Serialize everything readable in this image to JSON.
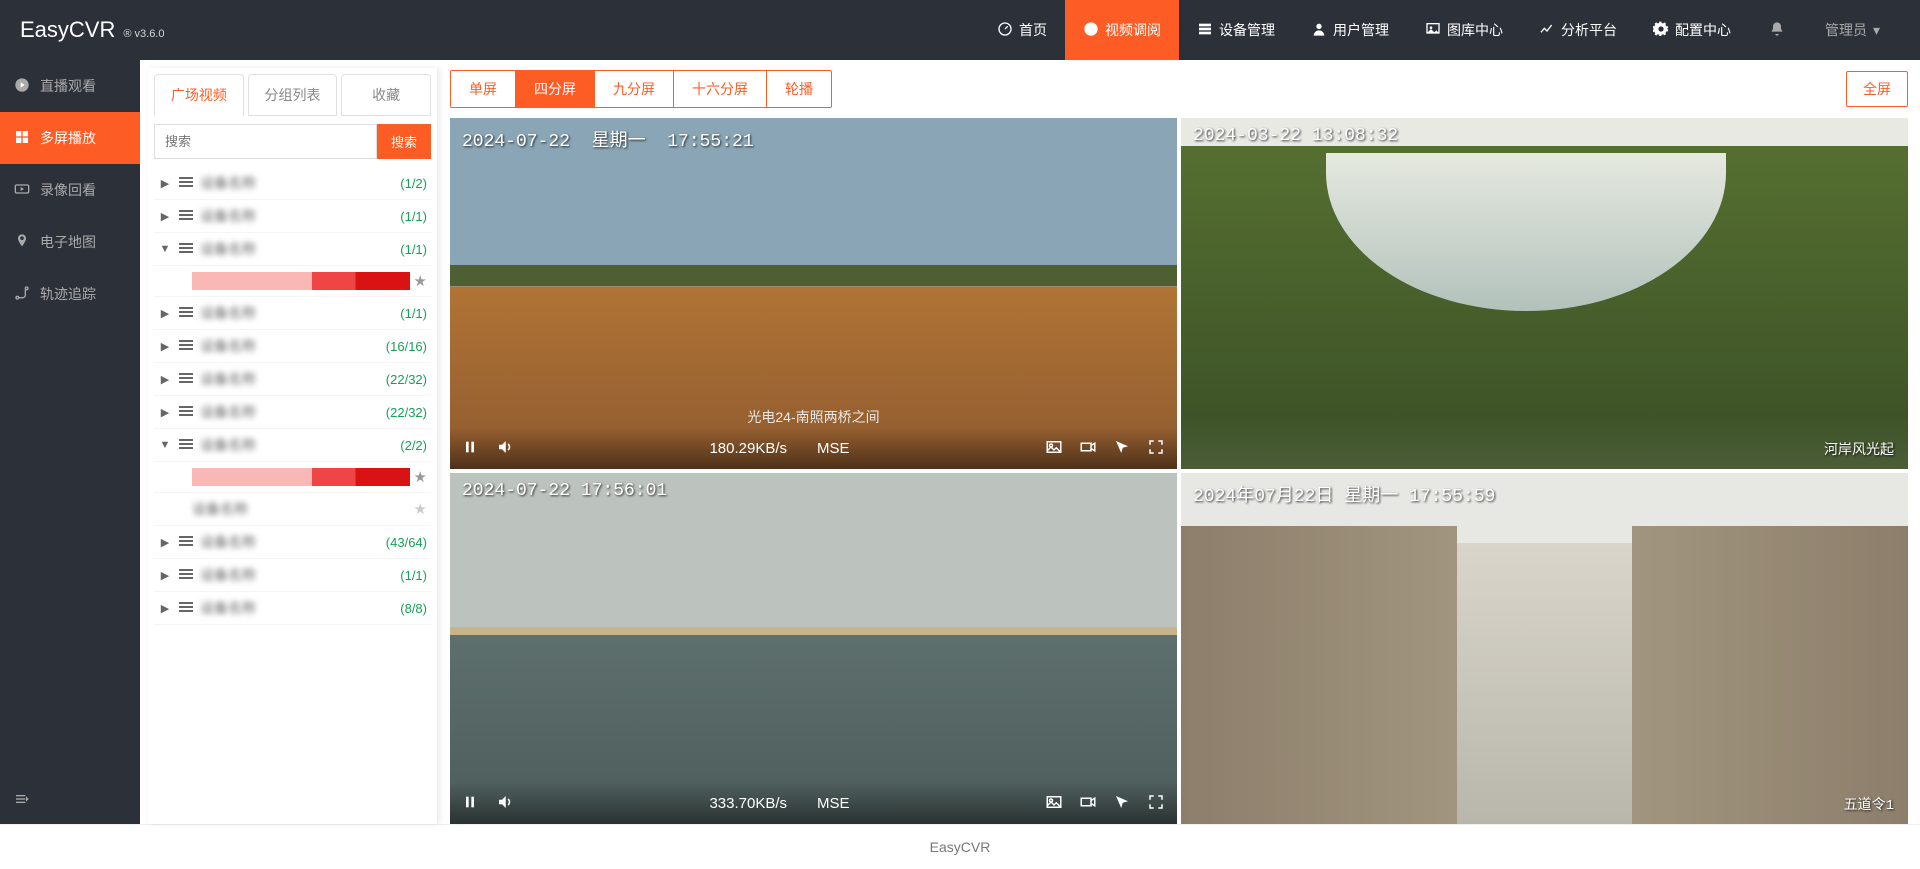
{
  "logo": {
    "title": "EasyCVR",
    "version": "® v3.6.0"
  },
  "nav": [
    {
      "label": "首页",
      "icon": "dashboard-icon"
    },
    {
      "label": "视频调阅",
      "icon": "play-icon",
      "active": true
    },
    {
      "label": "设备管理",
      "icon": "device-icon"
    },
    {
      "label": "用户管理",
      "icon": "user-icon"
    },
    {
      "label": "图库中心",
      "icon": "gallery-icon"
    },
    {
      "label": "分析平台",
      "icon": "chart-icon"
    },
    {
      "label": "配置中心",
      "icon": "gear-icon"
    }
  ],
  "admin": {
    "label": "管理员"
  },
  "sidebar": [
    {
      "label": "直播观看",
      "icon": "play-icon"
    },
    {
      "label": "多屏播放",
      "icon": "grid-icon",
      "active": true
    },
    {
      "label": "录像回看",
      "icon": "rewind-icon"
    },
    {
      "label": "电子地图",
      "icon": "map-icon"
    },
    {
      "label": "轨迹追踪",
      "icon": "route-icon"
    }
  ],
  "treeTabs": [
    {
      "label": "广场视频",
      "active": true
    },
    {
      "label": "分组列表"
    },
    {
      "label": "收藏"
    }
  ],
  "search": {
    "placeholder": "搜索",
    "button": "搜索"
  },
  "tree": [
    {
      "arrow": "▶",
      "indent": 0,
      "count": "(1/2)"
    },
    {
      "arrow": "▶",
      "indent": 0,
      "count": "(1/1)"
    },
    {
      "arrow": "▼",
      "indent": 0,
      "count": "(1/1)"
    },
    {
      "arrow": "",
      "indent": 1,
      "count": "",
      "redactedRed": true,
      "star": true
    },
    {
      "arrow": "▶",
      "indent": 0,
      "count": "(1/1)"
    },
    {
      "arrow": "▶",
      "indent": 0,
      "count": "(16/16)"
    },
    {
      "arrow": "▶",
      "indent": 0,
      "count": "(22/32)"
    },
    {
      "arrow": "▶",
      "indent": 0,
      "count": "(22/32)"
    },
    {
      "arrow": "▼",
      "indent": 0,
      "count": "(2/2)"
    },
    {
      "arrow": "",
      "indent": 1,
      "count": "",
      "redactedRed": true,
      "star": true
    },
    {
      "arrow": "",
      "indent": 1,
      "count": "",
      "starGray": true
    },
    {
      "arrow": "▶",
      "indent": 0,
      "count": "(43/64)"
    },
    {
      "arrow": "▶",
      "indent": 0,
      "count": "(1/1)"
    },
    {
      "arrow": "▶",
      "indent": 0,
      "count": "(8/8)"
    }
  ],
  "toolbar": {
    "layouts": [
      {
        "label": "单屏"
      },
      {
        "label": "四分屏",
        "active": true
      },
      {
        "label": "九分屏"
      },
      {
        "label": "十六分屏"
      },
      {
        "label": "轮播"
      }
    ],
    "fullscreen": "全屏"
  },
  "videos": [
    {
      "osd_tl": "2024-07-22  星期一  17:55:21",
      "scene": "river",
      "controls": true,
      "bitrate": "180.29KB/s",
      "codec": "MSE",
      "label_overlay": "光电24-南照两桥之间"
    },
    {
      "osd_tl": "2024-03-22 13:08:32 ",
      "scene": "forest",
      "controls": false,
      "br_label": "河岸风光起"
    },
    {
      "osd_tl": "2024-07-22 17:56:01",
      "scene": "bridge",
      "controls": true,
      "bitrate": "333.70KB/s",
      "codec": "MSE"
    },
    {
      "osd_tl": "2024年07月22日 星期一 17:55:59",
      "scene": "alley",
      "controls": false,
      "br_label": "五道令1"
    }
  ],
  "footer": "EasyCVR"
}
